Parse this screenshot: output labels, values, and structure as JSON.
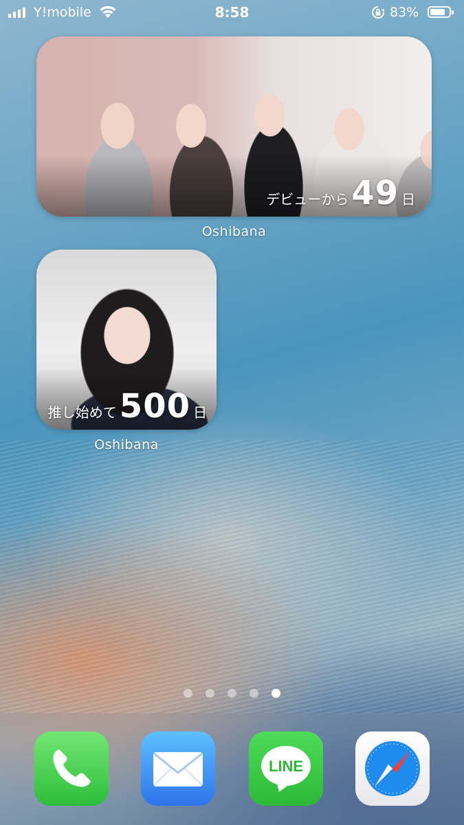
{
  "status_bar": {
    "carrier": "Y!mobile",
    "time": "8:58",
    "battery_percent": "83%",
    "battery_level": 0.83,
    "signal_bars": 4
  },
  "widgets": [
    {
      "label": "Oshibana",
      "prefix": "デビューから",
      "count": "49",
      "suffix": "日",
      "photo": "group-photo-five-people"
    },
    {
      "label": "Oshibana",
      "prefix": "推し始めて",
      "count": "500",
      "suffix": "日",
      "photo": "portrait-photo"
    }
  ],
  "page_dots": {
    "total": 5,
    "active_index": 4
  },
  "dock": [
    {
      "app": "Phone",
      "icon": "phone-icon",
      "color": "#34c759"
    },
    {
      "app": "Mail",
      "icon": "mail-icon",
      "color": "#2f74ec"
    },
    {
      "app": "LINE",
      "icon": "line-icon",
      "color": "#06c755",
      "text": "LINE"
    },
    {
      "app": "Safari",
      "icon": "safari-compass-icon",
      "color": "#1e88e5"
    }
  ]
}
